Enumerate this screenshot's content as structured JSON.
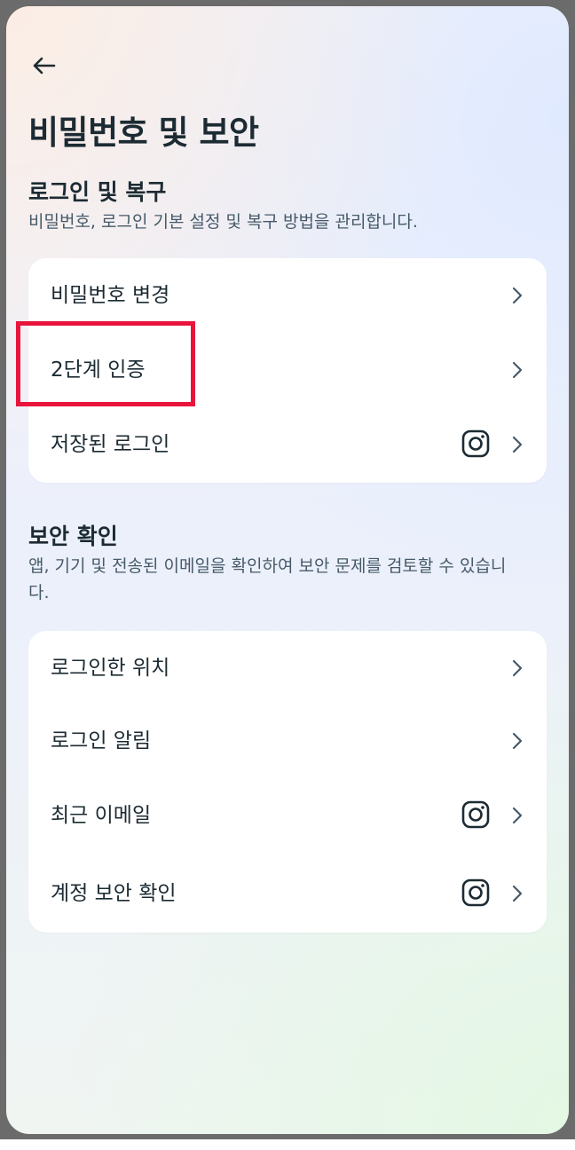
{
  "header": {
    "title": "비밀번호 및 보안"
  },
  "login_section": {
    "title": "로그인 및 복구",
    "description": "비밀번호, 로그인 기본 설정 및 복구 방법을 관리합니다.",
    "items": [
      {
        "label": "비밀번호 변경",
        "has_instagram_icon": false
      },
      {
        "label": "2단계 인증",
        "has_instagram_icon": false
      },
      {
        "label": "저장된 로그인",
        "has_instagram_icon": true
      }
    ]
  },
  "security_section": {
    "title": "보안 확인",
    "description": "앱, 기기 및 전송된 이메일을 확인하여 보안 문제를 검토할 수 있습니다.",
    "items": [
      {
        "label": "로그인한 위치",
        "has_instagram_icon": false
      },
      {
        "label": "로그인 알림",
        "has_instagram_icon": false
      },
      {
        "label": "최근 이메일",
        "has_instagram_icon": true
      },
      {
        "label": "계정 보안 확인",
        "has_instagram_icon": true
      }
    ]
  },
  "icons": {
    "back": "arrow-left-icon",
    "chevron": "chevron-right-icon",
    "instagram": "instagram-icon"
  },
  "colors": {
    "text_primary": "#1c2b33",
    "text_secondary": "#465a69",
    "highlight": "#e8143c",
    "card_bg": "#ffffff"
  }
}
